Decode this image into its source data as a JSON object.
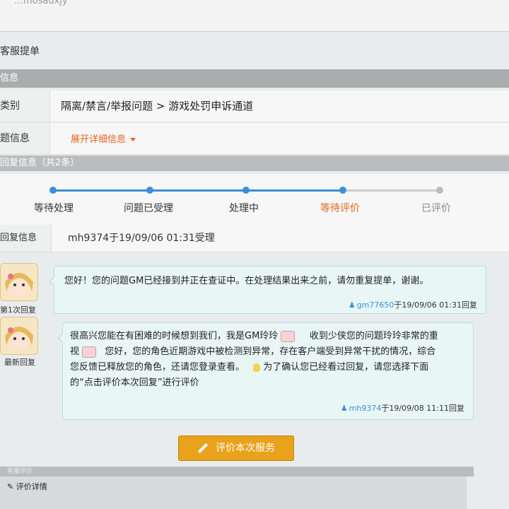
{
  "top": {
    "partial_text": "…mosauxjy"
  },
  "page": {
    "section_title": "客服提单",
    "info_header": "信息"
  },
  "fields": [
    {
      "label": "类别",
      "value": "隔离/禁言/举报问题 > 游戏处罚申诉通道"
    },
    {
      "label": "题信息",
      "link": "展开详细信息"
    }
  ],
  "reply_header": "回复信息（共2条）",
  "progress": {
    "steps": [
      "等待处理",
      "问题已受理",
      "处理中",
      "等待评价",
      "已评价"
    ],
    "current_index": 3,
    "colors": {
      "done": "#3a8fd6",
      "current": "#e7641b",
      "pending": "#bbbbbb"
    }
  },
  "reply_row": {
    "label": "回复信息",
    "value": "mh9374于19/09/06 01:31受理"
  },
  "replies": [
    {
      "side_label": "第1次回复",
      "text": "您好！您的问题GM已经接到并正在查证中。在处理结果出来之前，请勿重复提单，谢谢。",
      "author": "gm77650",
      "time": "于19/09/06 01:31回复"
    },
    {
      "side_label": "最新回复",
      "line1_a": "很高兴您能在有困难的时候想到我们，我是GM玲玲",
      "line1_b": "收到少侠您的问题玲玲非常的重",
      "line2_a": "视",
      "line2_b": "您好，您的角色近期游戏中被检测到异常，存在客户端受到异常干扰的情况，综合",
      "line3_a": "您反馈已释放您的角色，还请您登录查看。",
      "line3_b": "为了确认您已经看过回复，请您选择下面",
      "line4": "的“点击评价本次回复”进行评价",
      "author": "mh9374",
      "time": "于19/09/08 11:11回复"
    }
  ],
  "button": {
    "rate_label": "评价本次服务"
  },
  "bottom": {
    "header": "客服评价",
    "detail": "评价详情"
  }
}
